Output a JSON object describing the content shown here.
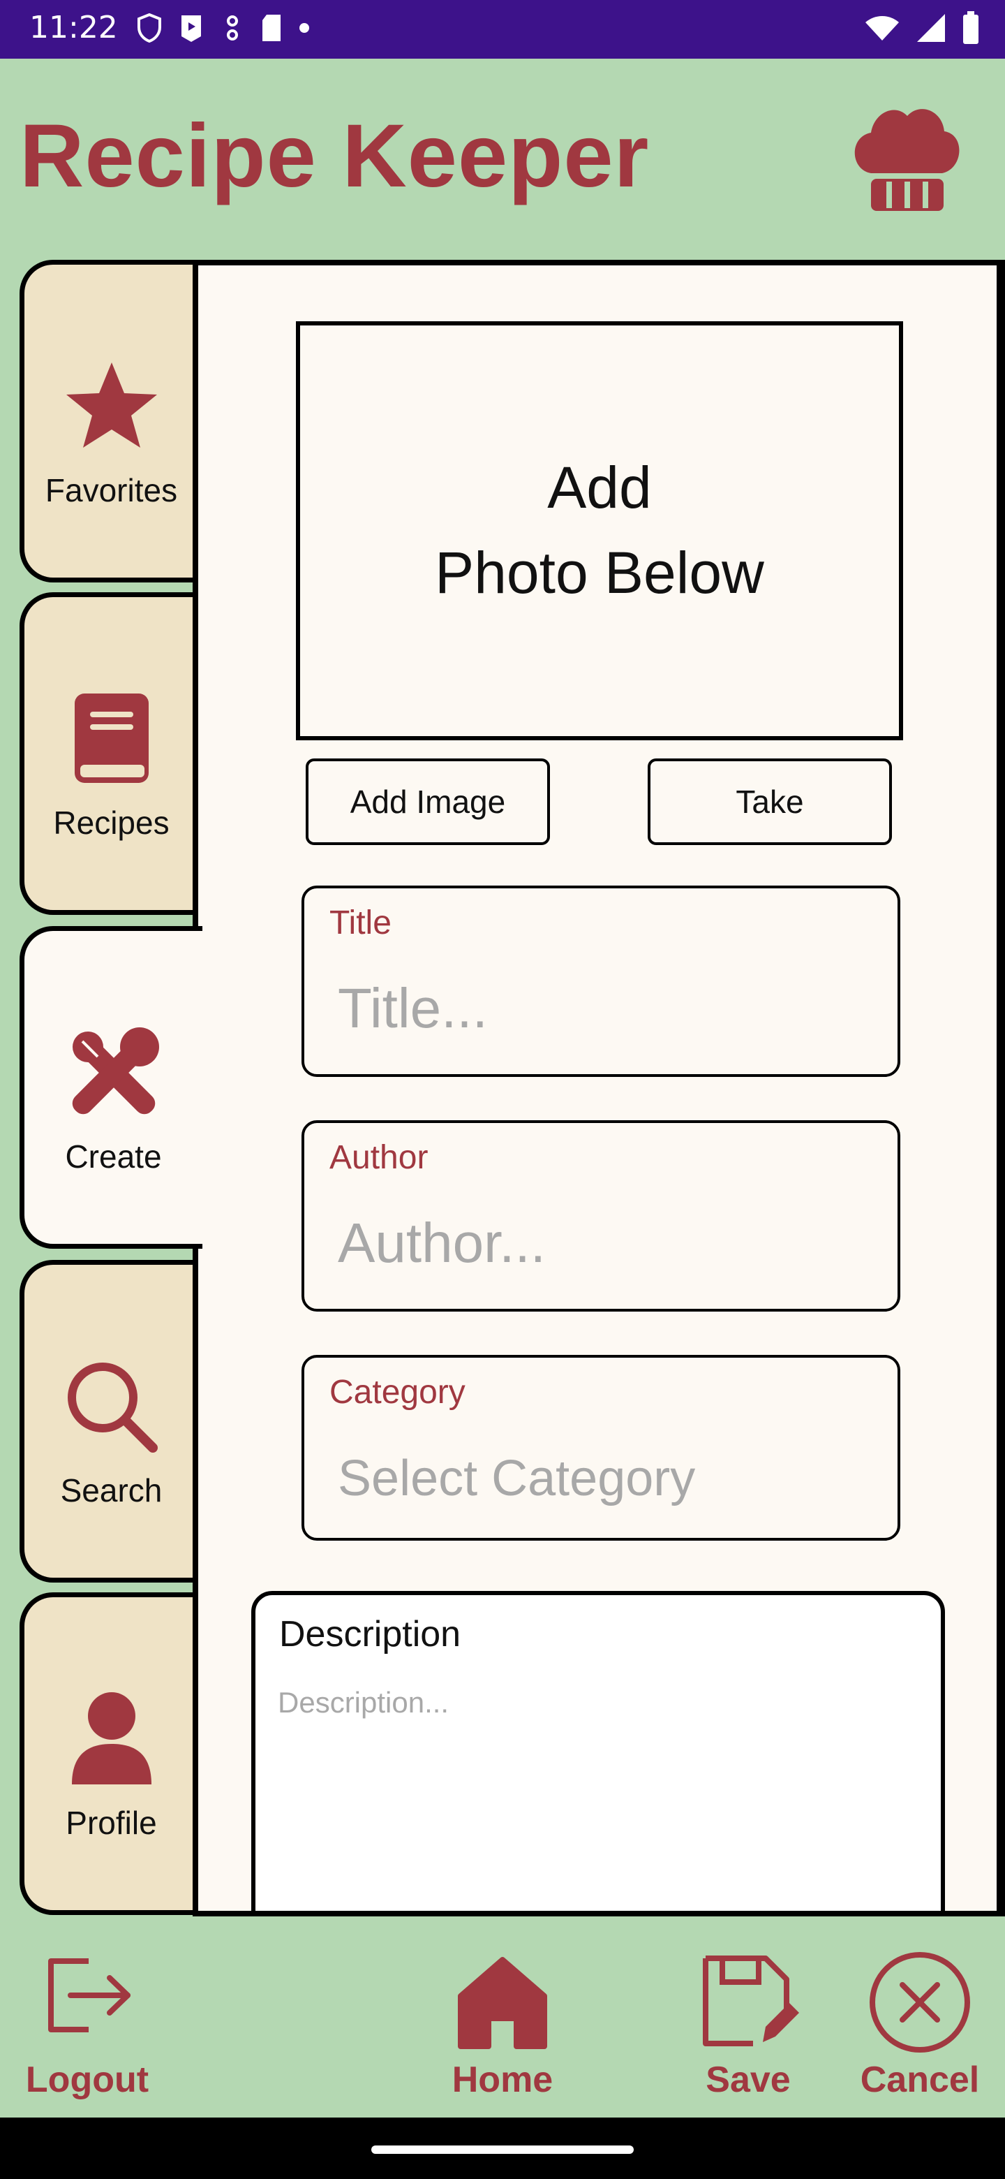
{
  "status_bar": {
    "time": "11:22"
  },
  "app": {
    "title": "Recipe Keeper"
  },
  "tabs": [
    {
      "label": "Favorites",
      "icon": "star-icon"
    },
    {
      "label": "Recipes",
      "icon": "book-icon"
    },
    {
      "label": "Create",
      "icon": "utensils-icon",
      "active": true
    },
    {
      "label": "Search",
      "icon": "search-icon"
    },
    {
      "label": "Profile",
      "icon": "person-icon"
    }
  ],
  "photo": {
    "placeholder_line1": "Add",
    "placeholder_line2": "Photo Below",
    "add_image_label": "Add Image",
    "take_label": "Take"
  },
  "form": {
    "title": {
      "label": "Title",
      "placeholder": "Title..."
    },
    "author": {
      "label": "Author",
      "placeholder": "Author..."
    },
    "category": {
      "label": "Category",
      "placeholder": "Select Category"
    },
    "description": {
      "label": "Description",
      "placeholder": "Description..."
    }
  },
  "bottom_nav": {
    "logout": "Logout",
    "home": "Home",
    "save": "Save",
    "cancel": "Cancel"
  },
  "colors": {
    "accent": "#a03840",
    "background": "#b4d8b2",
    "tab": "#efe3c6",
    "panel": "#fdf9f3",
    "status_bar": "#3d128a"
  }
}
